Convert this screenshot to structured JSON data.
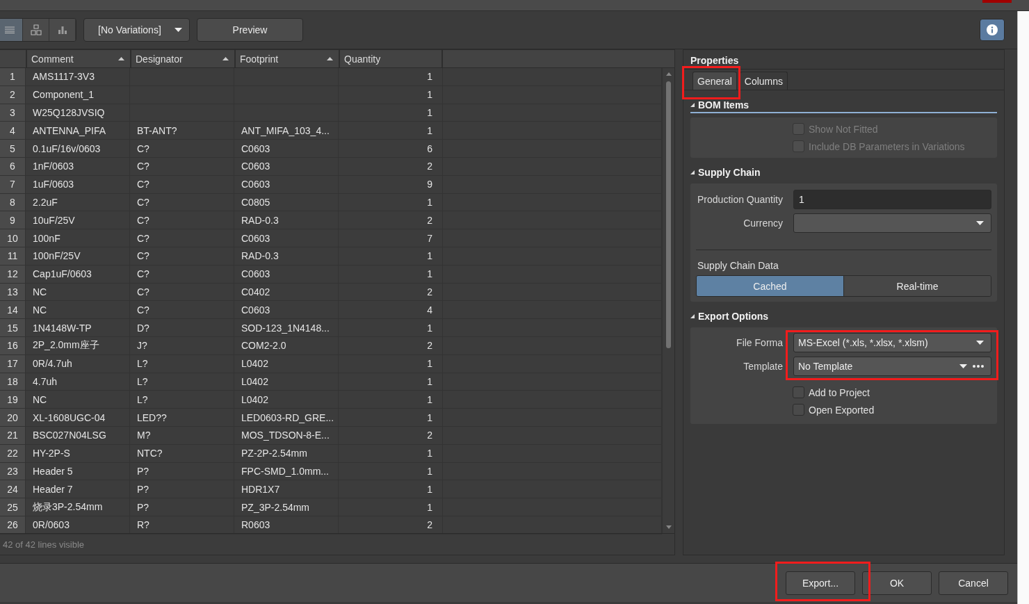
{
  "toolbar": {
    "view_buttons": [
      {
        "kind": "list",
        "selected": true
      },
      {
        "kind": "tree",
        "selected": false
      },
      {
        "kind": "chart",
        "selected": false
      }
    ],
    "variation": "[No Variations]",
    "preview_button": "Preview"
  },
  "table": {
    "columns": [
      {
        "label": "Comment",
        "sortable": true
      },
      {
        "label": "Designator",
        "sortable": true
      },
      {
        "label": "Footprint",
        "sortable": true
      },
      {
        "label": "Quantity",
        "sortable": false
      }
    ],
    "rows": [
      {
        "number": "1",
        "cells": [
          "AMS1117-3V3",
          "",
          "",
          "1"
        ]
      },
      {
        "number": "2",
        "cells": [
          "Component_1",
          "",
          "",
          "1"
        ]
      },
      {
        "number": "3",
        "cells": [
          "W25Q128JVSIQ",
          "",
          "",
          "1"
        ]
      },
      {
        "number": "4",
        "cells": [
          "ANTENNA_PIFA",
          "BT-ANT?",
          "ANT_MIFA_103_4...",
          "1"
        ]
      },
      {
        "number": "5",
        "cells": [
          "0.1uF/16v/0603",
          "C?",
          "C0603",
          "6"
        ]
      },
      {
        "number": "6",
        "cells": [
          "1nF/0603",
          "C?",
          "C0603",
          "2"
        ]
      },
      {
        "number": "7",
        "cells": [
          "1uF/0603",
          "C?",
          "C0603",
          "9"
        ]
      },
      {
        "number": "8",
        "cells": [
          "2.2uF",
          "C?",
          "C0805",
          "1"
        ]
      },
      {
        "number": "9",
        "cells": [
          "10uF/25V",
          "C?",
          "RAD-0.3",
          "2"
        ]
      },
      {
        "number": "10",
        "cells": [
          "100nF",
          "C?",
          "C0603",
          "7"
        ]
      },
      {
        "number": "11",
        "cells": [
          "100nF/25V",
          "C?",
          "RAD-0.3",
          "1"
        ]
      },
      {
        "number": "12",
        "cells": [
          "Cap1uF/0603",
          "C?",
          "C0603",
          "1"
        ]
      },
      {
        "number": "13",
        "cells": [
          "NC",
          "C?",
          "C0402",
          "2"
        ]
      },
      {
        "number": "14",
        "cells": [
          "NC",
          "C?",
          "C0603",
          "4"
        ]
      },
      {
        "number": "15",
        "cells": [
          "1N4148W-TP",
          "D?",
          "SOD-123_1N4148...",
          "1"
        ]
      },
      {
        "number": "16",
        "cells": [
          "2P_2.0mm座子",
          "J?",
          "COM2-2.0",
          "2"
        ]
      },
      {
        "number": "17",
        "cells": [
          "0R/4.7uh",
          "L?",
          "L0402",
          "1"
        ]
      },
      {
        "number": "18",
        "cells": [
          "4.7uh",
          "L?",
          "L0402",
          "1"
        ]
      },
      {
        "number": "19",
        "cells": [
          "NC",
          "L?",
          "L0402",
          "1"
        ]
      },
      {
        "number": "20",
        "cells": [
          "XL-1608UGC-04",
          "LED??",
          "LED0603-RD_GRE...",
          "1"
        ]
      },
      {
        "number": "21",
        "cells": [
          "BSC027N04LSG",
          "M?",
          "MOS_TDSON-8-E...",
          "2"
        ]
      },
      {
        "number": "22",
        "cells": [
          "HY-2P-S",
          "NTC?",
          "PZ-2P-2.54mm",
          "1"
        ]
      },
      {
        "number": "23",
        "cells": [
          "Header 5",
          "P?",
          "FPC-SMD_1.0mm...",
          "1"
        ]
      },
      {
        "number": "24",
        "cells": [
          "Header 7",
          "P?",
          "HDR1X7",
          "1"
        ]
      },
      {
        "number": "25",
        "cells": [
          "烧录3P-2.54mm",
          "P?",
          "PZ_3P-2.54mm",
          "1"
        ]
      },
      {
        "number": "26",
        "cells": [
          "0R/0603",
          "R?",
          "R0603",
          "2"
        ]
      }
    ],
    "status": "42 of 42 lines visible"
  },
  "properties": {
    "title": "Properties",
    "tabs": [
      {
        "label": "General",
        "selected": true
      },
      {
        "label": "Columns",
        "selected": false
      }
    ],
    "bom_items": {
      "heading": "BOM Items",
      "checkboxes": [
        {
          "label": "Show Not Fitted",
          "checked": false,
          "disabled": true
        },
        {
          "label": "Include DB Parameters in Variations",
          "checked": false,
          "disabled": true
        }
      ]
    },
    "supply_chain": {
      "heading": "Supply Chain",
      "production_quantity": {
        "label": "Production Quantity",
        "value": "1"
      },
      "currency": {
        "label": "Currency"
      },
      "data_label": "Supply Chain Data",
      "data_options": [
        {
          "label": "Cached",
          "selected": true
        },
        {
          "label": "Real-time",
          "selected": false
        }
      ]
    },
    "export_options": {
      "heading": "Export Options",
      "file_format": {
        "label": "File Forma",
        "value": "MS-Excel (*.xls, *.xlsx, *.xlsm)"
      },
      "template": {
        "label": "Template",
        "value": "No Template"
      },
      "checkboxes": [
        {
          "label": "Add to Project",
          "checked": false,
          "disabled": false
        },
        {
          "label": "Open Exported",
          "checked": false,
          "disabled": false
        }
      ]
    }
  },
  "footer": {
    "buttons": [
      "Export...",
      "OK",
      "Cancel"
    ]
  }
}
